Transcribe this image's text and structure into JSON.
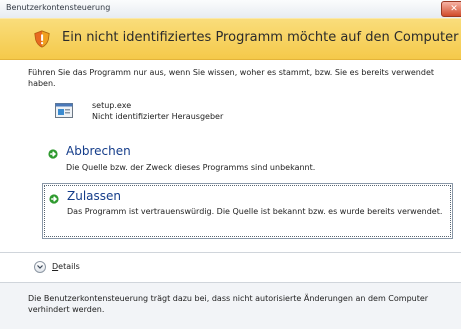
{
  "window": {
    "title": "Benutzerkontensteuerung",
    "close_glyph": "✕"
  },
  "banner": {
    "icon": "shield-warning-icon",
    "text": "Ein nicht identifiziertes Programm möchte auf den Computer zugreifen"
  },
  "intro": "Führen Sie das Programm nur aus, wenn Sie wissen, woher es stammt, bzw. Sie es bereits verwendet haben.",
  "program": {
    "icon": "program-icon",
    "name": "setup.exe",
    "publisher": "Nicht identifizierter Herausgeber"
  },
  "options": {
    "cancel": {
      "title": "Abbrechen",
      "description": "Die Quelle bzw. der Zweck dieses Programms sind unbekannt.",
      "icon": "green-arrow-icon"
    },
    "allow": {
      "title": "Zulassen",
      "description": "Das Programm ist vertrauenswürdig. Die Quelle ist bekannt bzw. es wurde bereits verwendet.",
      "icon": "green-arrow-icon"
    }
  },
  "details": {
    "first_letter": "D",
    "rest": "etails",
    "icon": "chevron-down-icon"
  },
  "footer": "Die Benutzerkontensteuerung trägt dazu bei, dass nicht autorisierte Änderungen an dem Computer verhindert werden.",
  "colors": {
    "banner": "#f5c94a",
    "link_title": "#153d8a",
    "arrow_green": "#2f9a2f",
    "close_red": "#d04b2a"
  }
}
